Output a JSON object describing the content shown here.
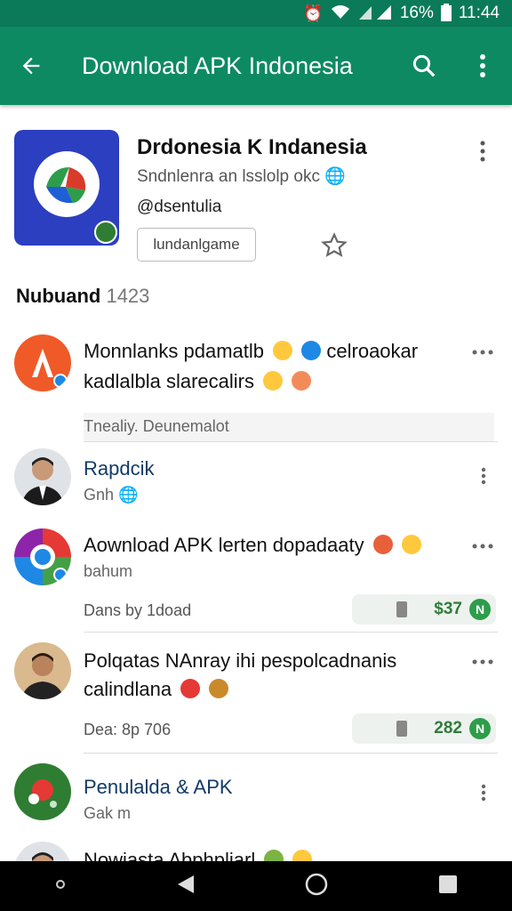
{
  "status": {
    "battery": "16%",
    "time": "11:44"
  },
  "appbar": {
    "title": "Download APK Indonesia"
  },
  "header": {
    "title": "Drdonesia K Indanesia",
    "subtitle": "Sndnlenra an lsslolp okc",
    "handle": "@dsentulia",
    "button_label": "lundanlgame"
  },
  "section": {
    "title": "Nubuand",
    "count": "1423"
  },
  "items": [
    {
      "line1": "Monnlanks pdamatlb",
      "line1b": "celroaokar",
      "line2": "kadlalbla slarecalirs",
      "meta": "Tnealiy. Deunemalot"
    },
    {
      "name": "Rapdcik",
      "meta": "Gnh"
    },
    {
      "line1": "Aownload APK lerten dopadaaty",
      "sub": "bahum",
      "foot": "Dans by 1doad",
      "chip_value": "$37"
    },
    {
      "line1": "Polqatas NAnray ihi pespolcadnanis",
      "line2": "calindlana",
      "foot": "Dea: 8p 706",
      "chip_value": "282"
    },
    {
      "name": "Penulalda & APK",
      "meta": "Gak m"
    },
    {
      "line1": "Nowiasta Abphpliarl"
    }
  ],
  "colors": {
    "appbar": "#0e8a63",
    "statusbar": "#0b7a58",
    "accent_green": "#2e9d4a"
  }
}
